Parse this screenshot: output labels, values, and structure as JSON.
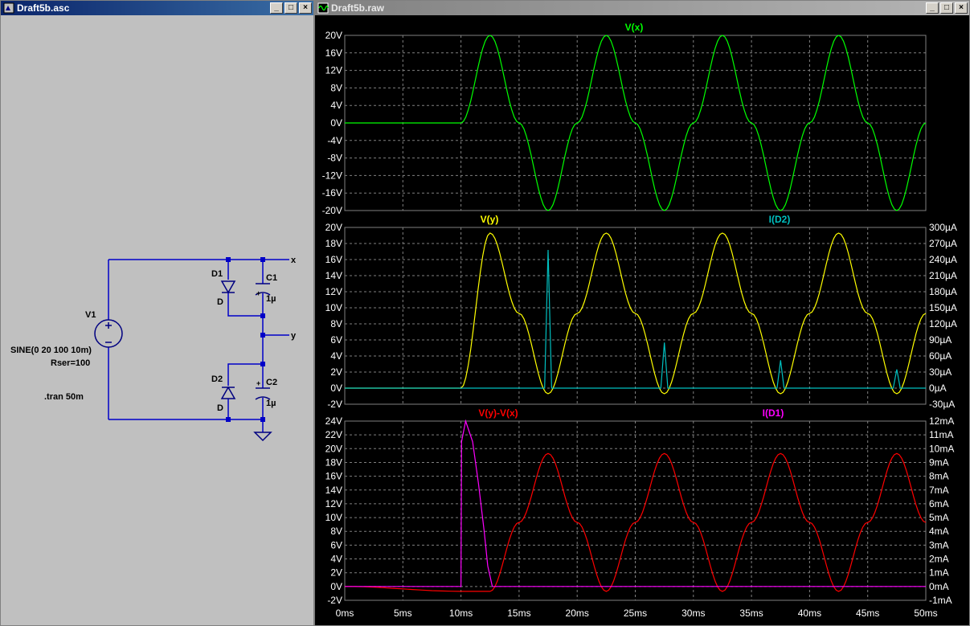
{
  "schematic_window": {
    "title": "Draft5b.asc",
    "components": {
      "v1_name": "V1",
      "v1_value": "SINE(0 20 100 10m)",
      "v1_rser": "Rser=100",
      "directive": ".tran 50m",
      "d1_name": "D1",
      "d1_model": "D",
      "d2_name": "D2",
      "d2_model": "D",
      "c1_name": "C1",
      "c1_value": "1µ",
      "c2_name": "C2",
      "c2_value": "1µ",
      "net_x": "x",
      "net_y": "y",
      "cap_plus": "+"
    },
    "colors": {
      "wire": "#0000c8",
      "component": "#000080",
      "text": "#000000"
    }
  },
  "waveform_window": {
    "title": "Draft5b.raw",
    "colors": {
      "background": "#000000",
      "grid": "#808080",
      "axis_text": "#ffffff"
    }
  },
  "window_buttons": {
    "minimize": "_",
    "maximize": "□",
    "close": "×"
  },
  "chart_data": [
    {
      "type": "line",
      "title": "",
      "x_axis": {
        "range": [
          0,
          50
        ],
        "unit": "ms",
        "tick_labels": [
          "0ms",
          "5ms",
          "10ms",
          "15ms",
          "20ms",
          "25ms",
          "30ms",
          "35ms",
          "40ms",
          "45ms",
          "50ms"
        ]
      },
      "y_axis_left": {
        "range": [
          -20,
          20
        ],
        "step": 4,
        "unit": "V",
        "tick_labels": [
          "20V",
          "16V",
          "12V",
          "8V",
          "4V",
          "0V",
          "-4V",
          "-8V",
          "-12V",
          "-16V",
          "-20V"
        ]
      },
      "grid": true,
      "series": [
        {
          "name": "V(x)",
          "color": "#00ff00",
          "axis": "left",
          "x": [
            0,
            10,
            12.5,
            15,
            17.5,
            20,
            22.5,
            25,
            27.5,
            30,
            32.5,
            35,
            37.5,
            40,
            42.5,
            45,
            47.5,
            50
          ],
          "y": [
            0,
            0,
            20,
            0,
            -20,
            0,
            20,
            0,
            -20,
            0,
            20,
            0,
            -20,
            0,
            20,
            0,
            -20,
            0
          ]
        }
      ]
    },
    {
      "type": "line",
      "title": "",
      "x_axis": {
        "range": [
          0,
          50
        ],
        "unit": "ms"
      },
      "y_axis_left": {
        "range": [
          -2,
          20
        ],
        "step": 2,
        "unit": "V",
        "tick_labels": [
          "20V",
          "18V",
          "16V",
          "14V",
          "12V",
          "10V",
          "8V",
          "6V",
          "4V",
          "2V",
          "0V",
          "-2V"
        ]
      },
      "y_axis_right": {
        "range": [
          -30,
          300
        ],
        "step": 30,
        "unit": "µA",
        "tick_labels": [
          "300µA",
          "270µA",
          "240µA",
          "210µA",
          "180µA",
          "150µA",
          "120µA",
          "90µA",
          "60µA",
          "30µA",
          "0µA",
          "-30µA"
        ]
      },
      "grid": true,
      "series": [
        {
          "name": "V(y)",
          "color": "#ffff00",
          "axis": "left",
          "x": [
            10,
            12.5,
            15,
            17.5,
            20,
            22.5,
            25,
            27.5,
            30,
            32.5,
            35,
            37.5,
            40,
            42.5,
            45,
            47.5,
            50
          ],
          "y": [
            0,
            19.3,
            9.3,
            -0.7,
            9.3,
            19.3,
            9.3,
            -0.7,
            9.3,
            19.3,
            9.3,
            -0.7,
            9.3,
            19.3,
            9.3,
            -0.7,
            9.3
          ]
        },
        {
          "name": "I(D2)",
          "color": "#00c0c0",
          "axis": "right",
          "x": [
            0,
            17.2,
            17.5,
            17.8,
            27.2,
            27.5,
            27.8,
            37.2,
            37.5,
            37.8,
            47.2,
            47.5,
            47.8,
            50
          ],
          "y": [
            0,
            0,
            258,
            0,
            0,
            85,
            0,
            0,
            52,
            0,
            0,
            35,
            0,
            0
          ]
        }
      ]
    },
    {
      "type": "line",
      "title": "",
      "x_axis": {
        "range": [
          0,
          50
        ],
        "unit": "ms",
        "tick_labels": [
          "0ms",
          "5ms",
          "10ms",
          "15ms",
          "20ms",
          "25ms",
          "30ms",
          "35ms",
          "40ms",
          "45ms",
          "50ms"
        ]
      },
      "y_axis_left": {
        "range": [
          -2,
          24
        ],
        "step": 2,
        "unit": "V",
        "tick_labels": [
          "24V",
          "22V",
          "20V",
          "18V",
          "16V",
          "14V",
          "12V",
          "10V",
          "8V",
          "6V",
          "4V",
          "2V",
          "0V",
          "-2V"
        ]
      },
      "y_axis_right": {
        "range": [
          -1,
          12
        ],
        "step": 1,
        "unit": "mA",
        "tick_labels": [
          "12mA",
          "11mA",
          "10mA",
          "9mA",
          "8mA",
          "7mA",
          "6mA",
          "5mA",
          "4mA",
          "3mA",
          "2mA",
          "1mA",
          "0mA",
          "-1mA"
        ]
      },
      "grid": true,
      "series": [
        {
          "name": "V(y)-V(x)",
          "color": "#ff0000",
          "axis": "left",
          "x": [
            10,
            12.5,
            15,
            17.5,
            20,
            22.5,
            25,
            27.5,
            30,
            32.5,
            35,
            37.5,
            40,
            42.5,
            45,
            47.5,
            50
          ],
          "y": [
            -0.7,
            -0.7,
            9.3,
            19.3,
            9.3,
            -0.7,
            9.3,
            19.3,
            9.3,
            -0.7,
            9.3,
            19.3,
            9.3,
            -0.7,
            9.3,
            19.3,
            9.3
          ]
        },
        {
          "name": "I(D1)",
          "color": "#ff00ff",
          "axis": "right",
          "x": [
            0,
            10,
            10.05,
            10.4,
            11,
            11.5,
            12,
            12.3,
            12.7,
            50
          ],
          "y": [
            0,
            0,
            10.5,
            12,
            10.5,
            7.5,
            4,
            1.5,
            0,
            0
          ]
        }
      ]
    }
  ]
}
